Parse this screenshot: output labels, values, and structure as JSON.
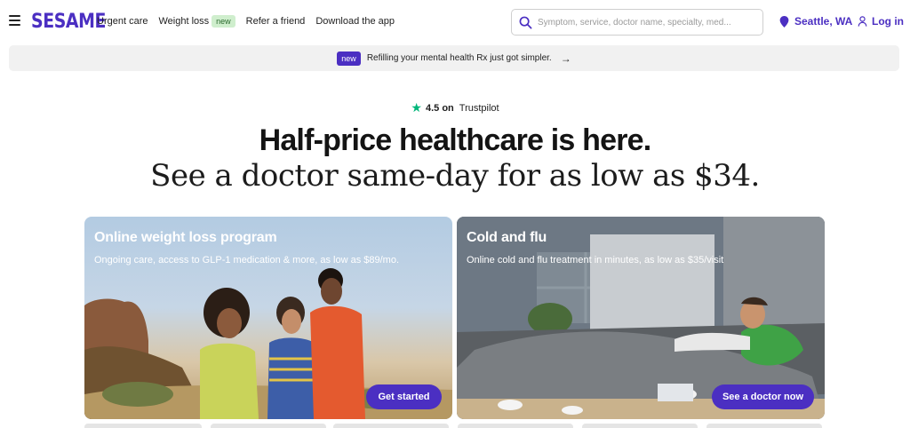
{
  "header": {
    "logo": "SESAME",
    "nav": [
      {
        "label": "Urgent care"
      },
      {
        "label": "Weight loss",
        "badge": "new"
      },
      {
        "label": "Refer a friend"
      },
      {
        "label": "Download the app"
      }
    ],
    "search_placeholder": "Symptom, service, doctor name, specialty, med...",
    "location": "Seattle, WA",
    "login": "Log in",
    "icons": {
      "menu": "hamburger-icon",
      "search": "search-icon",
      "location": "location-pin-icon",
      "login": "user-icon"
    }
  },
  "announcement": {
    "badge": "new",
    "text": "Refilling your mental health Rx just got simpler.",
    "arrow": "→"
  },
  "trust": {
    "score": "4.5 on",
    "brand": "Trustpilot"
  },
  "hero": {
    "headline": "Half-price healthcare is here.",
    "subheadline": "See a doctor same-day for as low as $34."
  },
  "cards": [
    {
      "title": "Online weight loss program",
      "subtitle": "Ongoing care, access to GLP-1 medication & more, as low as $89/mo.",
      "button": "Get started"
    },
    {
      "title": "Cold and flu",
      "subtitle": "Online cold and flu treatment in minutes, as low as $35/visit",
      "button": "See a doctor now"
    }
  ],
  "colors": {
    "brand": "#4b2fc2",
    "trustpilot": "#00b67a",
    "new_badge_green": "#cfeecd"
  }
}
